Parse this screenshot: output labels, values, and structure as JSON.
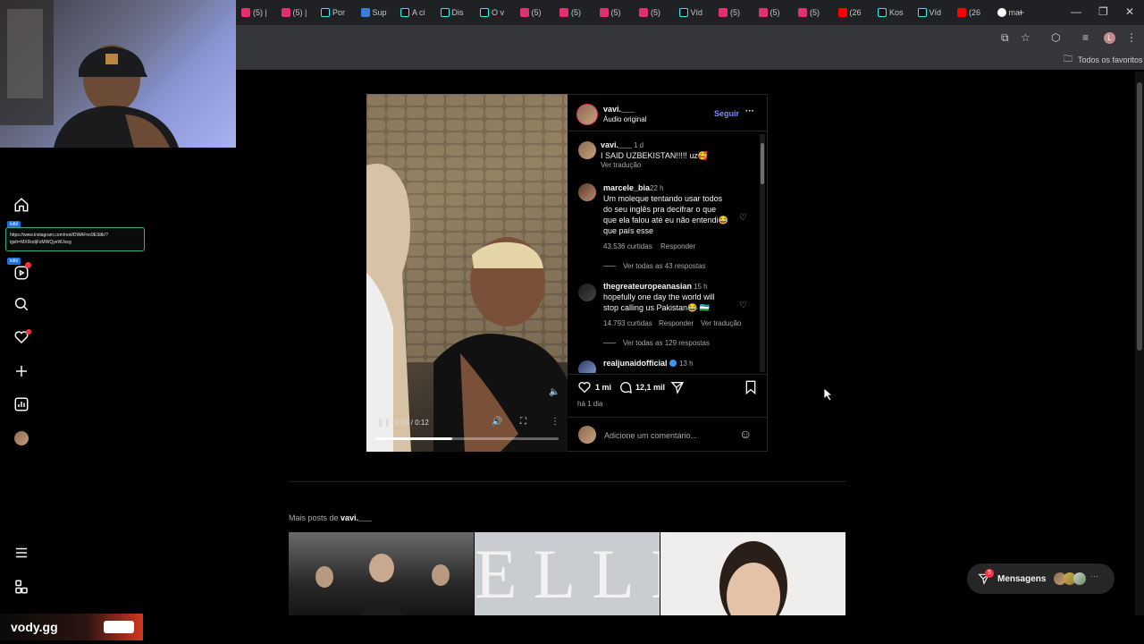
{
  "browser": {
    "tabs": [
      {
        "label": "(5) |",
        "icon": "instagram"
      },
      {
        "label": "(5) |",
        "icon": "instagram"
      },
      {
        "label": "Por",
        "icon": "tiktok"
      },
      {
        "label": "Sup",
        "icon": "app"
      },
      {
        "label": "A ci",
        "icon": "tiktok"
      },
      {
        "label": "Dis",
        "icon": "tiktok"
      },
      {
        "label": "O v",
        "icon": "tiktok"
      },
      {
        "label": "(5)",
        "icon": "instagram"
      },
      {
        "label": "(5)",
        "icon": "instagram"
      },
      {
        "label": "(5)",
        "icon": "instagram"
      },
      {
        "label": "(5)",
        "icon": "instagram"
      },
      {
        "label": "Víd",
        "icon": "tiktok"
      },
      {
        "label": "(5)",
        "icon": "instagram"
      },
      {
        "label": "(5)",
        "icon": "instagram"
      },
      {
        "label": "(5)",
        "icon": "instagram"
      },
      {
        "label": "(26",
        "icon": "youtube"
      },
      {
        "label": "Kos",
        "icon": "tiktok"
      },
      {
        "label": "Víd",
        "icon": "tiktok"
      },
      {
        "label": "(26",
        "icon": "youtube"
      },
      {
        "label": "ma",
        "icon": "google"
      }
    ],
    "bookmarks_label": "Todos os favoritos",
    "profile_initial": "L"
  },
  "overlay": {
    "badge1": "kdbl",
    "badge2": "kdbl",
    "url_line1": "https://www.instagram.com/reel/DWAFno9ESttk/?",
    "url_line2": "igsh=MXRodjFzMWQyeWJocg"
  },
  "post": {
    "author": "vavi.___",
    "audio": "Áudio original",
    "follow": "Seguir",
    "more": "···",
    "video_time": "0:05 / 0:12",
    "caption": {
      "user": "vavi.___",
      "time": "1 d",
      "text": "I SAID UZBEKISTAN!!!!! uz🥰",
      "translate": "Ver tradução"
    },
    "comments": [
      {
        "user": "marcele_bia",
        "time": "22 h",
        "lines": [
          "Um moleque tentando usar todos",
          "do seu inglês pra decifrar o que",
          "que ela falou até eu não entendi😂",
          "que país esse"
        ],
        "likes": "43.536 curtidas",
        "reply": "Responder",
        "translate": "",
        "view_replies": "Ver todas as 43 respostas"
      },
      {
        "user": "thegreateuropeanasian",
        "time": "15 h",
        "lines": [
          "hopefully one day the world will",
          "stop calling us Pakistan😂 🇺🇿"
        ],
        "likes": "14.793 curtidas",
        "reply": "Responder",
        "translate": "Ver tradução",
        "view_replies": "Ver todas as 129 respostas"
      },
      {
        "user": "realjunaidofficial",
        "time": "13 h",
        "lines": [],
        "likes": "",
        "reply": "",
        "translate": "",
        "view_replies": ""
      }
    ],
    "likes_count": "1 mi",
    "comments_count": "12,1 mil",
    "posted": "há 1 dia",
    "add_comment_placeholder": "Adicione um comentário..."
  },
  "more_posts": {
    "prefix": "Mais posts de ",
    "user": "vavi.___"
  },
  "messages": {
    "label": "Mensagens",
    "badge": "5"
  },
  "watermark": "vody.gg"
}
